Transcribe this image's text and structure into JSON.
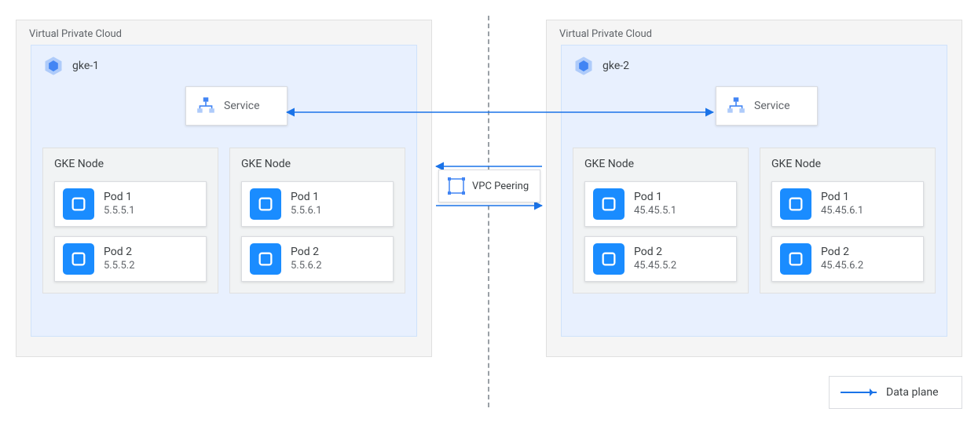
{
  "legend": {
    "label": "Data plane"
  },
  "center": {
    "peering_label": "VPC Peering"
  },
  "left_vpc": {
    "title": "Virtual Private Cloud",
    "cluster": {
      "name": "gke-1",
      "service_label": "Service",
      "nodes": [
        {
          "title": "GKE Node",
          "pods": [
            {
              "name": "Pod 1",
              "ip": "5.5.5.1"
            },
            {
              "name": "Pod 2",
              "ip": "5.5.5.2"
            }
          ]
        },
        {
          "title": "GKE Node",
          "pods": [
            {
              "name": "Pod 1",
              "ip": "5.5.6.1"
            },
            {
              "name": "Pod 2",
              "ip": "5.5.6.2"
            }
          ]
        }
      ]
    }
  },
  "right_vpc": {
    "title": "Virtual Private Cloud",
    "cluster": {
      "name": "gke-2",
      "service_label": "Service",
      "nodes": [
        {
          "title": "GKE Node",
          "pods": [
            {
              "name": "Pod 1",
              "ip": "45.45.5.1"
            },
            {
              "name": "Pod 2",
              "ip": "45.45.5.2"
            }
          ]
        },
        {
          "title": "GKE Node",
          "pods": [
            {
              "name": "Pod 1",
              "ip": "45.45.6.1"
            },
            {
              "name": "Pod 2",
              "ip": "45.45.6.2"
            }
          ]
        }
      ]
    }
  }
}
